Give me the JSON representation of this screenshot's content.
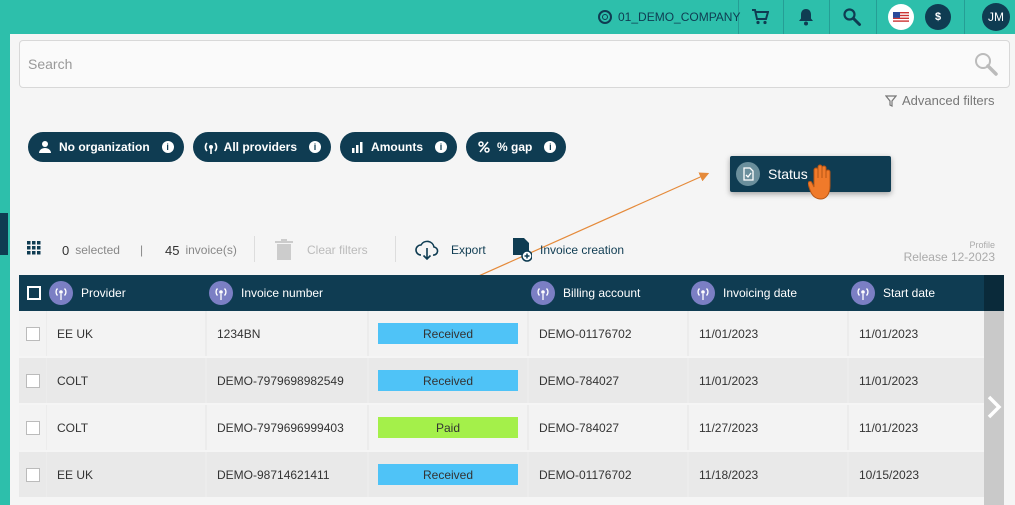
{
  "topbar": {
    "company": "01_DEMO_COMPANY",
    "flag": "US",
    "currency": "$",
    "user_initials": "JM"
  },
  "search": {
    "placeholder": "Search"
  },
  "advanced_filters": "Advanced filters",
  "filter_pills": [
    {
      "label": "No organization",
      "icon": "org-icon"
    },
    {
      "label": "All providers",
      "icon": "provider-icon"
    },
    {
      "label": "Amounts",
      "icon": "amount-icon"
    },
    {
      "label": "% gap",
      "icon": "percent-icon"
    }
  ],
  "dragged_column": "Status",
  "toolbar": {
    "selected_count": "0",
    "selected_label": "selected",
    "separator": "|",
    "invoice_count": "45",
    "invoice_label": "invoice(s)",
    "clear_filters": "Clear filters",
    "export": "Export",
    "invoice_creation": "Invoice creation",
    "profile": "Profile",
    "release": "Release 12-2023"
  },
  "table": {
    "headers": [
      "Provider",
      "Invoice number",
      "Billing account",
      "Invoicing date",
      "Start date"
    ],
    "rows": [
      {
        "provider": "EE UK",
        "invoice_number": "1234BN",
        "status": "Received",
        "billing_account": "DEMO-01176702",
        "invoicing_date": "11/01/2023",
        "start_date": "11/01/2023"
      },
      {
        "provider": "COLT",
        "invoice_number": "DEMO-7979698982549",
        "status": "Received",
        "billing_account": "DEMO-784027",
        "invoicing_date": "11/01/2023",
        "start_date": "11/01/2023"
      },
      {
        "provider": "COLT",
        "invoice_number": "DEMO-7979696999403",
        "status": "Paid",
        "billing_account": "DEMO-784027",
        "invoicing_date": "11/27/2023",
        "start_date": "11/01/2023"
      },
      {
        "provider": "EE UK",
        "invoice_number": "DEMO-98714621411",
        "status": "Received",
        "billing_account": "DEMO-01176702",
        "invoicing_date": "11/18/2023",
        "start_date": "10/15/2023"
      }
    ]
  },
  "colors": {
    "accent": "#2dbfab",
    "navy": "#0f3c52",
    "received": "#4fc3f7",
    "paid": "#a4f04a",
    "header_icon": "#7b7fc4"
  }
}
